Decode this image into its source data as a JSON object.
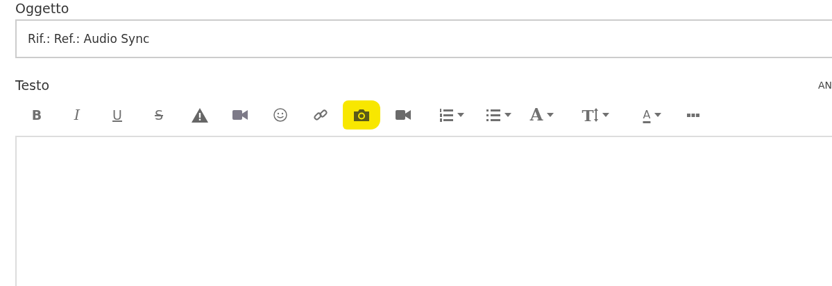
{
  "subject": {
    "label": "Oggetto",
    "value": "Rif.: Ref.: Audio Sync"
  },
  "body": {
    "label": "Testo",
    "side_label": "AN"
  },
  "toolbar": [
    {
      "kind": "bold",
      "label": "B",
      "highlighted": false
    },
    {
      "kind": "italic",
      "label": "I",
      "highlighted": false
    },
    {
      "kind": "underline",
      "label": "U",
      "highlighted": false
    },
    {
      "kind": "strike",
      "label": "S",
      "highlighted": false
    },
    {
      "kind": "warning",
      "highlighted": false
    },
    {
      "kind": "video-soft",
      "highlighted": false
    },
    {
      "kind": "emoji",
      "highlighted": false
    },
    {
      "kind": "link",
      "highlighted": false
    },
    {
      "kind": "camera",
      "highlighted": true
    },
    {
      "kind": "video",
      "highlighted": false
    },
    {
      "kind": "ordered-list",
      "dropdown": true,
      "highlighted": false
    },
    {
      "kind": "bullet-list",
      "dropdown": true,
      "highlighted": false
    },
    {
      "kind": "font",
      "label": "A",
      "dropdown": true,
      "highlighted": false
    },
    {
      "kind": "size",
      "label": "T",
      "dropdown": true,
      "highlighted": false
    },
    {
      "kind": "color",
      "label": "A",
      "dropdown": true,
      "highlighted": false
    },
    {
      "kind": "more",
      "highlighted": false
    }
  ]
}
